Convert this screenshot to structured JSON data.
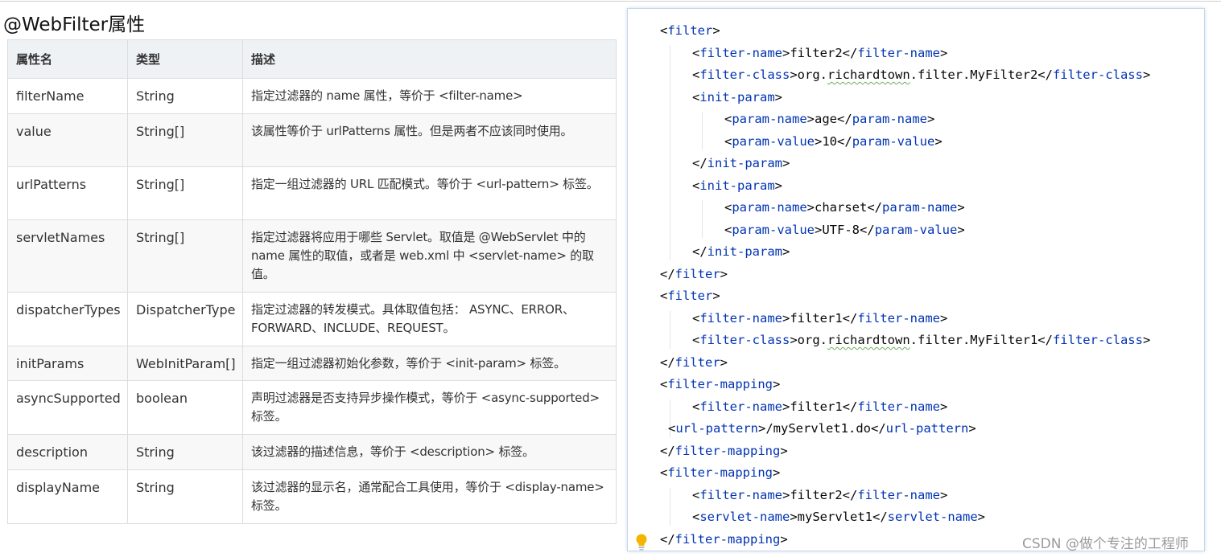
{
  "doc": {
    "title": "@WebFilter属性",
    "table": {
      "headers": [
        "属性名",
        "类型",
        "描述"
      ],
      "rows": [
        {
          "name": "filterName",
          "type": "String",
          "desc": "指定过滤器的 name 属性，等价于 <filter-name>"
        },
        {
          "name": "value",
          "type": "String[]",
          "desc": "该属性等价于 urlPatterns 属性。但是两者不应该同时使用。"
        },
        {
          "name": "urlPatterns",
          "type": "String[]",
          "desc": "指定一组过滤器的 URL 匹配模式。等价于 <url-pattern> 标签。"
        },
        {
          "name": "servletNames",
          "type": "String[]",
          "desc": "指定过滤器将应用于哪些 Servlet。取值是 @WebServlet 中的 name 属性的取值，或者是 web.xml 中 <servlet-name> 的取值。"
        },
        {
          "name": "dispatcherTypes",
          "type": "DispatcherType",
          "desc": "指定过滤器的转发模式。具体取值包括： ASYNC、ERROR、FORWARD、INCLUDE、REQUEST。"
        },
        {
          "name": "initParams",
          "type": "WebInitParam[]",
          "desc": "指定一组过滤器初始化参数，等价于 <init-param> 标签。"
        },
        {
          "name": "asyncSupported",
          "type": "boolean",
          "desc": "声明过滤器是否支持异步操作模式，等价于 <async-supported> 标签。"
        },
        {
          "name": "description",
          "type": "String",
          "desc": "该过滤器的描述信息，等价于 <description> 标签。"
        },
        {
          "name": "displayName",
          "type": "String",
          "desc": "该过滤器的显示名，通常配合工具使用，等价于 <display-name> 标签。"
        }
      ]
    }
  },
  "code": {
    "lines": [
      {
        "indent": 0,
        "tag": "filter",
        "kind": "open"
      },
      {
        "indent": 1,
        "tag": "filter-name",
        "kind": "inline",
        "text": "filter2"
      },
      {
        "indent": 1,
        "tag": "filter-class",
        "kind": "inline",
        "text": "org.richardtown.filter.MyFilter2",
        "squiggle": "richardtown"
      },
      {
        "indent": 1,
        "tag": "init-param",
        "kind": "open"
      },
      {
        "indent": 2,
        "tag": "param-name",
        "kind": "inline",
        "text": "age"
      },
      {
        "indent": 2,
        "tag": "param-value",
        "kind": "inline",
        "text": "10"
      },
      {
        "indent": 1,
        "tag": "init-param",
        "kind": "close"
      },
      {
        "indent": 1,
        "tag": "init-param",
        "kind": "open"
      },
      {
        "indent": 2,
        "tag": "param-name",
        "kind": "inline",
        "text": "charset"
      },
      {
        "indent": 2,
        "tag": "param-value",
        "kind": "inline",
        "text": "UTF-8"
      },
      {
        "indent": 1,
        "tag": "init-param",
        "kind": "close"
      },
      {
        "indent": 0,
        "tag": "filter",
        "kind": "close"
      },
      {
        "indent": 0,
        "tag": "filter",
        "kind": "open"
      },
      {
        "indent": 1,
        "tag": "filter-name",
        "kind": "inline",
        "text": "filter1"
      },
      {
        "indent": 1,
        "tag": "filter-class",
        "kind": "inline",
        "text": "org.richardtown.filter.MyFilter1",
        "squiggle": "richardtown"
      },
      {
        "indent": 0,
        "tag": "filter",
        "kind": "close"
      },
      {
        "indent": 0,
        "tag": "filter-mapping",
        "kind": "open"
      },
      {
        "indent": 1,
        "tag": "filter-name",
        "kind": "inline",
        "text": "filter1"
      },
      {
        "indent": 0.25,
        "tag": "url-pattern",
        "kind": "inline",
        "text": "/myServlet1.do"
      },
      {
        "indent": 0,
        "tag": "filter-mapping",
        "kind": "close"
      },
      {
        "indent": 0,
        "tag": "filter-mapping",
        "kind": "open"
      },
      {
        "indent": 1,
        "tag": "filter-name",
        "kind": "inline",
        "text": "filter2"
      },
      {
        "indent": 1,
        "tag": "servlet-name",
        "kind": "inline",
        "text": "myServlet1"
      },
      {
        "indent": 0,
        "tag": "filter-mapping",
        "kind": "close"
      }
    ],
    "guides": [
      {
        "from": 1,
        "to": 11,
        "level": 0
      },
      {
        "from": 4,
        "to": 6,
        "level": 1
      },
      {
        "from": 8,
        "to": 10,
        "level": 1
      },
      {
        "from": 13,
        "to": 15,
        "level": 0
      },
      {
        "from": 17,
        "to": 19,
        "level": 0
      },
      {
        "from": 21,
        "to": 23,
        "level": 0
      }
    ]
  },
  "watermark": "CSDN @做个专注的工程师",
  "colors": {
    "xml_tag": "#0033b3",
    "xml_text": "#080808",
    "table_header_bg": "#eff2f5",
    "table_odd_row_bg": "#f8f8f8",
    "bulb": "#f4b400"
  },
  "icons": {
    "bulb": "intention-bulb-icon"
  }
}
